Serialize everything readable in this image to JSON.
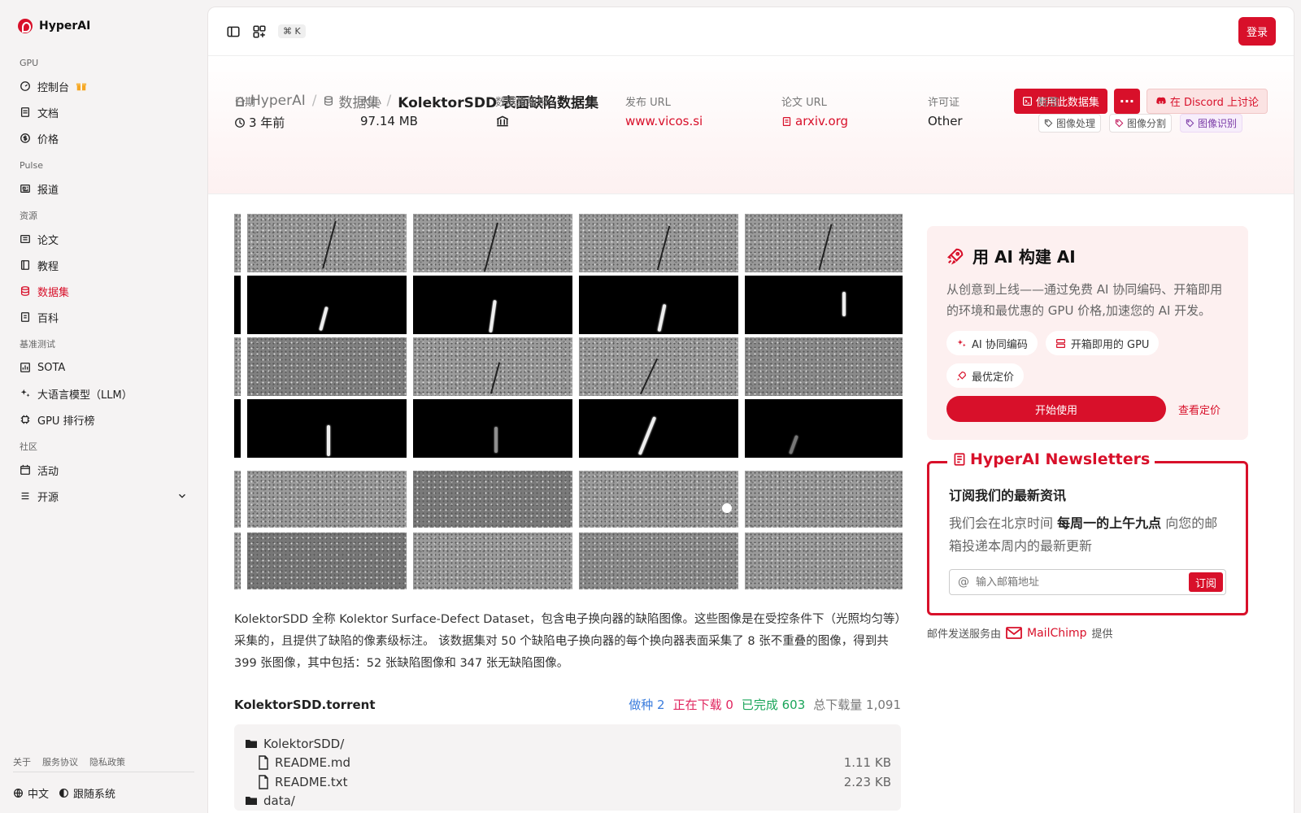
{
  "brand": {
    "name": "HyperAI"
  },
  "sidebar": {
    "groups": [
      {
        "label": "GPU",
        "items": [
          {
            "label": "控制台"
          },
          {
            "label": "文档"
          },
          {
            "label": "价格"
          }
        ]
      },
      {
        "label": "Pulse",
        "items": [
          {
            "label": "报道"
          }
        ]
      },
      {
        "label": "资源",
        "items": [
          {
            "label": "论文"
          },
          {
            "label": "教程"
          },
          {
            "label": "数据集"
          },
          {
            "label": "百科"
          }
        ]
      },
      {
        "label": "基准测试",
        "items": [
          {
            "label": "SOTA"
          },
          {
            "label": "大语言模型（LLM）"
          },
          {
            "label": "GPU 排行榜"
          }
        ]
      },
      {
        "label": "社区",
        "items": [
          {
            "label": "活动"
          },
          {
            "label": "开源"
          }
        ]
      }
    ],
    "footer_links": [
      "关于",
      "服务协议",
      "隐私政策"
    ],
    "language": "中文",
    "theme": "跟随系统"
  },
  "topbar": {
    "shortcut": "⌘ K",
    "login": "登录"
  },
  "breadcrumb": {
    "home": "HyperAI",
    "section": "数据集",
    "current": "KolektorSDD 表面缺陷数据集"
  },
  "actions": {
    "use_dataset": "使用此数据集",
    "discord": "在 Discord 上讨论"
  },
  "meta": {
    "date": {
      "label": "日期",
      "value": "3 年前"
    },
    "size": {
      "label": "大小",
      "value": "97.14 MB"
    },
    "org": {
      "label": "数据集组织"
    },
    "release_url": {
      "label": "发布 URL",
      "value": "www.vicos.si"
    },
    "paper_url": {
      "label": "论文 URL",
      "value": "arxiv.org"
    },
    "license": {
      "label": "许可证",
      "value": "Other"
    },
    "tags": {
      "label": "标签",
      "items": [
        "图像处理",
        "图像分割",
        "图像识别"
      ]
    }
  },
  "description": "KolektorSDD 全称 Kolektor Surface-Defect Dataset，包含电子换向器的缺陷图像。这些图像是在受控条件下（光照均匀等）采集的，且提供了缺陷的像素级标注。 该数据集对 50 个缺陷电子换向器的每个换向器表面采集了 8 张不重叠的图像，得到共 399 张图像，其中包括：52 张缺陷图像和 347 张无缺陷图像。",
  "torrent": {
    "name": "KolektorSDD.torrent",
    "seeding": "做种 2",
    "downloading": "正在下载 0",
    "completed": "已完成 603",
    "total": "总下载量 1,091",
    "files": [
      {
        "name": "KolektorSDD/",
        "size": "",
        "type": "folder",
        "level": 0
      },
      {
        "name": "README.md",
        "size": "1.11 KB",
        "type": "file",
        "level": 1
      },
      {
        "name": "README.txt",
        "size": "2.23 KB",
        "type": "file",
        "level": 1
      },
      {
        "name": "data/",
        "size": "",
        "type": "folder",
        "level": 0
      }
    ]
  },
  "ai_card": {
    "title": "用 AI 构建 AI",
    "desc": "从创意到上线——通过免费 AI 协同编码、开箱即用的环境和最优惠的 GPU 价格,加速您的 AI 开发。",
    "chips": [
      "AI 协同编码",
      "开箱即用的 GPU",
      "最优定价"
    ],
    "start": "开始使用",
    "pricing": "查看定价"
  },
  "newsletter": {
    "title": "HyperAI Newsletters",
    "heading": "订阅我们的最新资讯",
    "text_pre": "我们会在北京时间",
    "text_bold": "每周一的上午九点",
    "text_post": "向您的邮箱投递本周内的最新更新",
    "placeholder": "输入邮箱地址",
    "button": "订阅",
    "provider_pre": "邮件发送服务由",
    "provider": "MailChimp",
    "provider_post": "提供"
  }
}
